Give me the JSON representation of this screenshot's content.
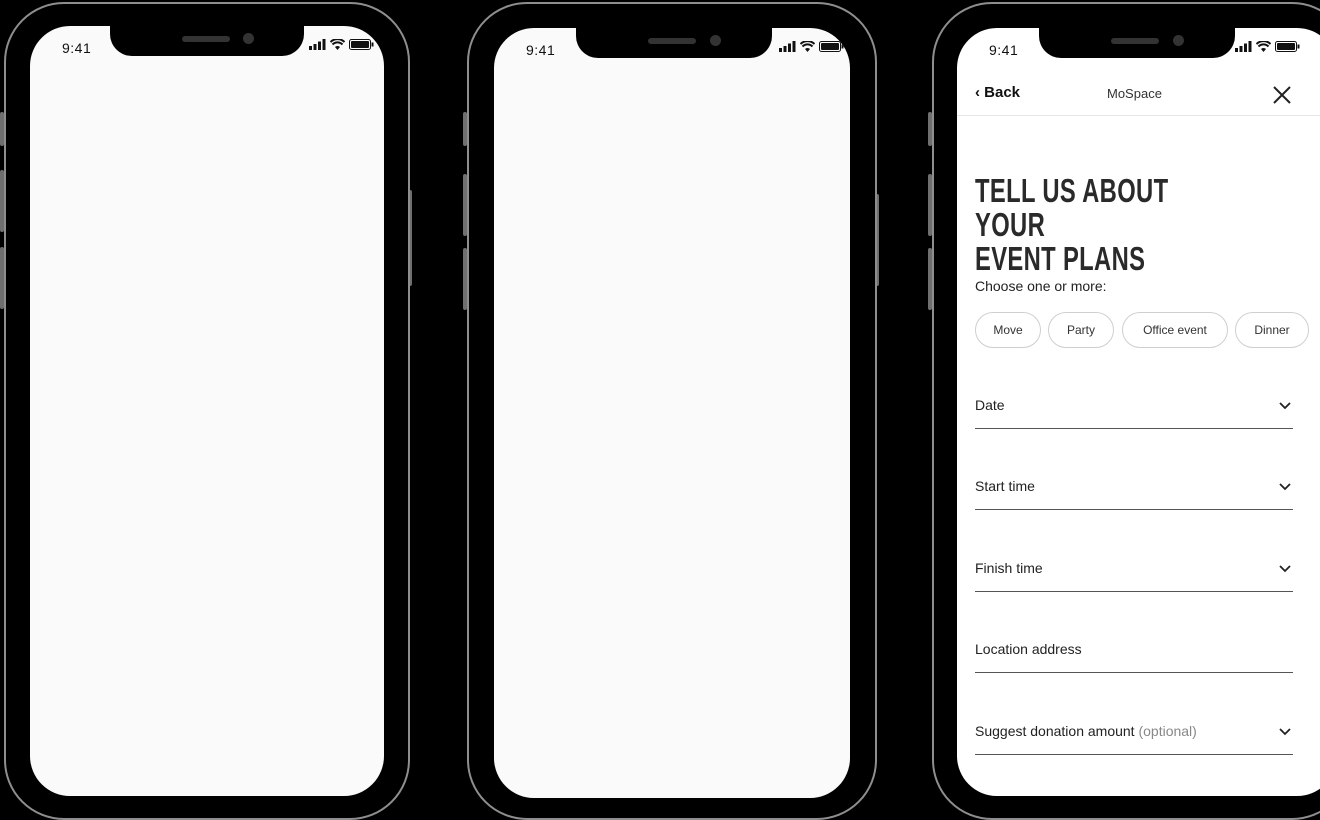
{
  "phones": [
    {
      "clock": "9:41"
    },
    {
      "clock": "9:41"
    },
    {
      "clock": "9:41"
    }
  ],
  "screen3": {
    "nav": {
      "back_label": "‹ Back",
      "title": "MoSpace"
    },
    "headline_line1": "TELL US ABOUT YOUR",
    "headline_line2": "EVENT PLANS",
    "choose_label": "Choose one or more:",
    "chips": [
      "Move",
      "Party",
      "Office event",
      "Dinner"
    ],
    "fields": {
      "date": "Date",
      "start_time": "Start time",
      "finish_time": "Finish time",
      "location": "Location address",
      "donation": "Suggest donation amount",
      "donation_optional": "(optional)"
    }
  },
  "colors": {
    "screen_bg": "#fafafa",
    "frame": "#8e8e8e",
    "text": "#222222"
  },
  "icons": [
    "signal-icon",
    "wifi-icon",
    "battery-icon",
    "close-icon",
    "chevron-down-icon"
  ]
}
